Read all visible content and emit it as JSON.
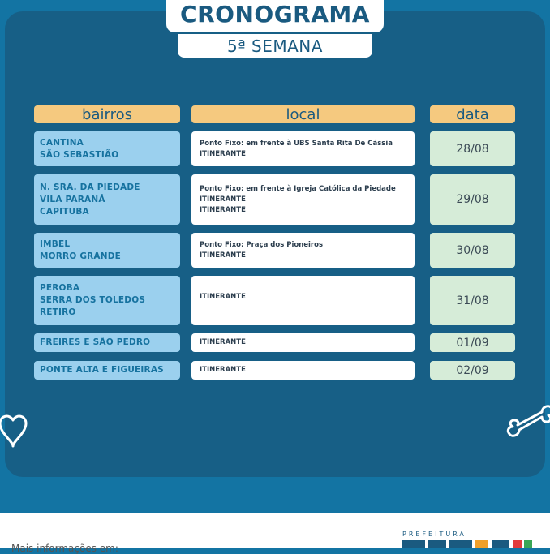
{
  "header": {
    "title": "CRONOGRAMA",
    "subtitle": "5ª SEMANA"
  },
  "columns": {
    "bairros": "bairros",
    "local": "local",
    "data": "data"
  },
  "rows": [
    {
      "bairros": [
        "CANTINA",
        "SÃO SEBASTIÃO"
      ],
      "local": [
        "Ponto Fixo: em frente à UBS Santa Rita De Cássia",
        "ITINERANTE"
      ],
      "data": "28/08"
    },
    {
      "bairros": [
        "N. SRA. DA PIEDADE",
        "VILA PARANÁ",
        "CAPITUBA"
      ],
      "local": [
        "Ponto Fixo: em frente à Igreja Católica da Piedade",
        "ITINERANTE",
        "ITINERANTE"
      ],
      "data": "29/08"
    },
    {
      "bairros": [
        "IMBEL",
        "MORRO GRANDE"
      ],
      "local": [
        "Ponto Fixo: Praça dos Pioneiros",
        "ITINERANTE"
      ],
      "data": "30/08"
    },
    {
      "bairros": [
        "PEROBA",
        "SERRA DOS TOLEDOS",
        "RETIRO"
      ],
      "local": [
        "ITINERANTE"
      ],
      "data": "31/08"
    },
    {
      "bairros": [
        "FREIRES E SÃO PEDRO"
      ],
      "local": [
        "ITINERANTE"
      ],
      "data": "01/09"
    },
    {
      "bairros": [
        "PONTE ALTA E FIGUEIRAS"
      ],
      "local": [
        "ITINERANTE"
      ],
      "data": "02/09"
    }
  ],
  "footer": {
    "info": "Mais informações em:",
    "logo_prefix": "PREFEITURA"
  },
  "colors": {
    "panel": "#175f86",
    "background": "#1374a3",
    "header_fill": "#f5c97f",
    "bairro_fill": "#9bd0ee",
    "data_fill": "#d6ecd8"
  }
}
